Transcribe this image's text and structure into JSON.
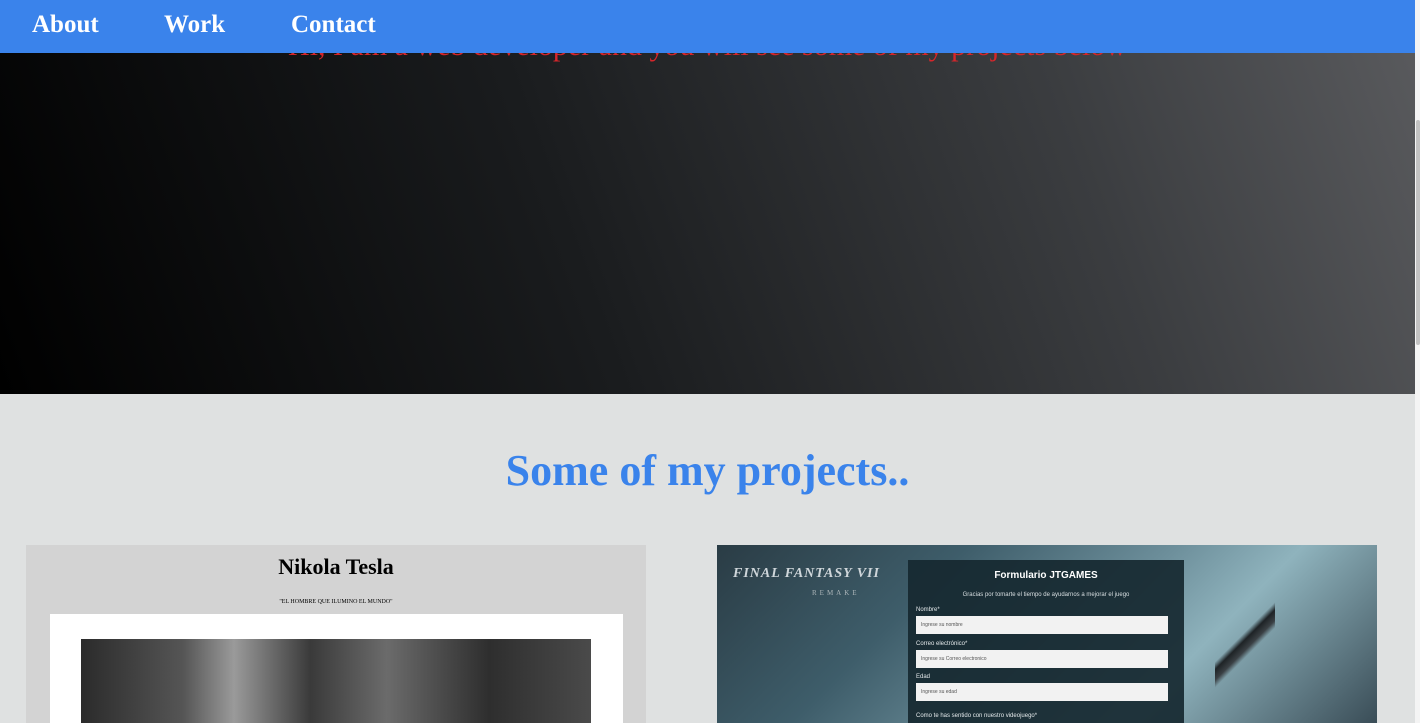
{
  "nav": {
    "items": [
      {
        "label": "About"
      },
      {
        "label": "Work"
      },
      {
        "label": "Contact"
      }
    ]
  },
  "hero": {
    "intro": "Hi, I am a web developer and you will see some of my projects below"
  },
  "projects": {
    "title": "Some of my projects..",
    "cards": [
      {
        "title": "Nikola Tesla",
        "quote": "\"EL HOMBRE QUE ILUMINO EL MUNDO\""
      },
      {
        "logo": "FINAL FANTASY VII",
        "logo_sub": "REMAKE",
        "form_title": "Formulario JTGAMES",
        "form_subtitle": "Gracias por tomarte el tiempo de ayudarnos a mejorar el juego",
        "fields": [
          {
            "label": "Nombre*",
            "placeholder": "Ingrese su nombre"
          },
          {
            "label": "Correo electrónico*",
            "placeholder": "Ingrese su Correo electronico"
          },
          {
            "label": "Edad",
            "placeholder": "Ingrese su edad"
          },
          {
            "label": "Como te has sentido con nuestro videojuego*"
          }
        ]
      }
    ]
  },
  "colors": {
    "nav_bg": "#3a83eb",
    "accent": "#3a83eb",
    "intro_text": "#d5262b",
    "section_bg": "#dfe1e1"
  }
}
